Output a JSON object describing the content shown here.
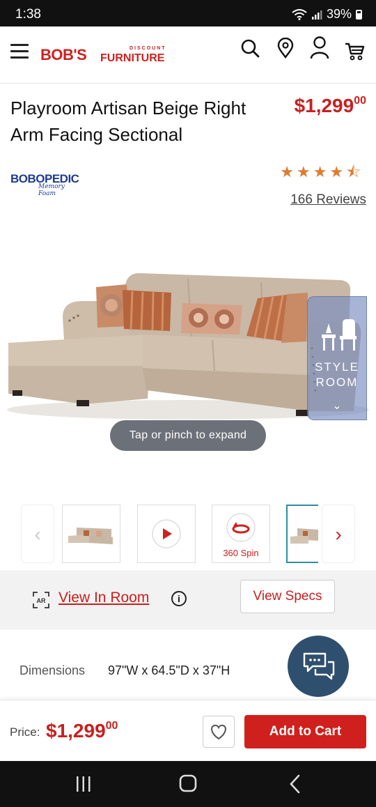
{
  "status_bar": {
    "time": "1:38",
    "battery": "39%"
  },
  "header": {
    "logo_discount": "DISCOUNT",
    "logo_bobs": "BOB'S",
    "logo_furniture": "FURNITURE",
    "icons": [
      "menu-icon",
      "search-icon",
      "location-pin-icon",
      "account-icon",
      "cart-icon"
    ]
  },
  "product": {
    "title": "Playroom Artisan Beige Right Arm Facing Sectional",
    "price_main": "$1,299",
    "price_cents": "00",
    "brand_logo_text": "BOBOPEDIC",
    "brand_logo_sub": "Memory Foam",
    "rating_stars": 4.5,
    "reviews": "166 Reviews",
    "style_room_label": "STYLE ROOM",
    "tap_hint": "Tap or pinch to expand",
    "spin_label": "360 Spin"
  },
  "actions": {
    "view_in_room": "View In Room",
    "ar_badge": "AR",
    "view_specs": "View Specs"
  },
  "dimensions": {
    "label": "Dimensions",
    "value": "97\"W x 64.5\"D x 37\"H"
  },
  "buy_bar": {
    "price_label": "Price:",
    "price_main": "$1,299",
    "price_cents": "00",
    "add_to_cart": "Add to Cart"
  },
  "colors": {
    "brand_red": "#d0201d",
    "star_orange": "#e07b2e",
    "chat_navy": "#2f4f6e",
    "thumb_active": "#2a8fa0"
  }
}
